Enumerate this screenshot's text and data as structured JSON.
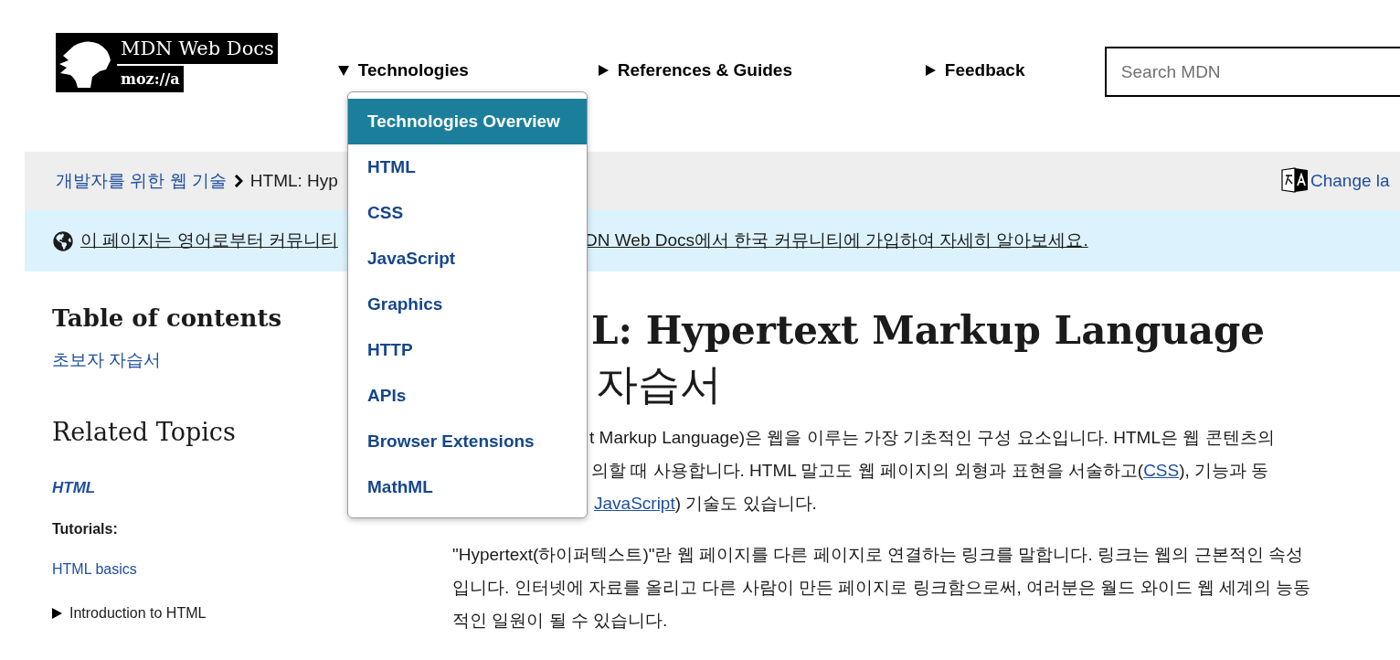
{
  "header": {
    "logo": {
      "title": "MDN Web Docs",
      "subtitle": "moz://a"
    },
    "nav": [
      {
        "label": "Technologies",
        "expanded": true
      },
      {
        "label": "References & Guides",
        "expanded": false
      },
      {
        "label": "Feedback",
        "expanded": false
      }
    ],
    "search": {
      "placeholder": "Search MDN"
    }
  },
  "menu": {
    "items": [
      {
        "label": "Technologies Overview",
        "selected": true
      },
      {
        "label": "HTML",
        "selected": false
      },
      {
        "label": "CSS",
        "selected": false
      },
      {
        "label": "JavaScript",
        "selected": false
      },
      {
        "label": "Graphics",
        "selected": false
      },
      {
        "label": "HTTP",
        "selected": false
      },
      {
        "label": "APIs",
        "selected": false
      },
      {
        "label": "Browser Extensions",
        "selected": false
      },
      {
        "label": "MathML",
        "selected": false
      }
    ]
  },
  "breadcrumb": {
    "parent": "개발자를 위한 웹 기술",
    "current": "HTML: Hyp",
    "change_language": "Change la"
  },
  "notice": {
    "parts": [
      "이 페이지는 영어로부터 커뮤니티",
      "DN Web Docs에서 한국 커뮤니티에 가입하여 자세히 알아보세요."
    ]
  },
  "sidebar": {
    "toc_title": "Table of contents",
    "toc_items": [
      "초보자 자습서"
    ],
    "related_title": "Related Topics",
    "items": [
      {
        "kind": "heading",
        "label": "HTML"
      },
      {
        "kind": "label",
        "label": "Tutorials:"
      },
      {
        "kind": "link",
        "label": "HTML basics"
      },
      {
        "kind": "group",
        "label": "Introduction to HTML",
        "expanded": false
      }
    ]
  },
  "article": {
    "title_line1": "L: Hypertext Markup Language",
    "title_line2": "자습서",
    "intro_lines": [
      [
        {
          "kind": "text",
          "text": "t Markup Language)은 웹을 이루는 가장 기초적인 구성 요소입니다. HTML은 웹 콘텐츠의"
        }
      ],
      [
        {
          "kind": "text",
          "text": "의할 때 사용합니다. HTML 말고도 웹 페이지의 외형과 표현을 서술하고("
        },
        {
          "kind": "link",
          "text": "CSS"
        },
        {
          "kind": "text",
          "text": "), 기능과 동"
        }
      ],
      [
        {
          "kind": "link",
          "text": "JavaScript"
        },
        {
          "kind": "text",
          "text": ") 기술도 있습니다."
        }
      ]
    ],
    "paragraph": "\"Hypertext(하이퍼텍스트)\"란 웹 페이지를 다른 페이지로 연결하는 링크를 말합니다. 링크는 웹의 근본적인 속성입니다. 인터넷에 자료를 올리고 다른 사람이 만든 페이지로 링크함으로써, 여러분은 월드 와이드 웹 세계의 능동적인 일원이 될 수 있습니다."
  }
}
